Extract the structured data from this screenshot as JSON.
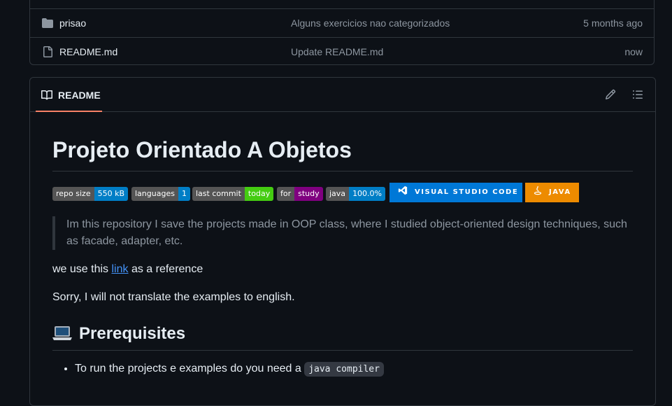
{
  "files": [
    {
      "icon": "folder-icon",
      "name": "prisao",
      "message": "Alguns exercicios nao categorizados",
      "age": "5 months ago"
    },
    {
      "icon": "file-icon",
      "name": "README.md",
      "message": "Update README.md",
      "age": "now"
    }
  ],
  "readme": {
    "tab_label": "README",
    "title": "Projeto Orientado A Objetos",
    "badges": [
      {
        "label": "repo size",
        "value": "550 kB",
        "color": "#007ec6"
      },
      {
        "label": "languages",
        "value": "1",
        "color": "#007ec6"
      },
      {
        "label": "last commit",
        "value": "today",
        "color": "#4c1"
      },
      {
        "label": "for",
        "value": "study",
        "color": "#800080"
      },
      {
        "label": "java",
        "value": "100.0%",
        "color": "#007ec6"
      }
    ],
    "big_badges": [
      {
        "text": "VISUAL STUDIO CODE",
        "icon": "vscode-icon",
        "color": "#0078d7"
      },
      {
        "text": "JAVA",
        "icon": "java-icon",
        "color": "#ed8b00"
      }
    ],
    "quote": "Im this repository I save the projects made in OOP class, where I studied object-oriented design techniques, such as facade, adapter, etc.",
    "ref_before": "we use this ",
    "ref_link": "link",
    "ref_after": " as a reference",
    "sorry": "Sorry, I will not translate the examples to english.",
    "prereq_title": "Prerequisites",
    "prereq_item_text": "To run the projects e examples do you need a ",
    "prereq_item_code": "java compiler"
  },
  "colors": {
    "accent": "#f78166",
    "link": "#4493f8",
    "muted": "#8d96a0"
  }
}
